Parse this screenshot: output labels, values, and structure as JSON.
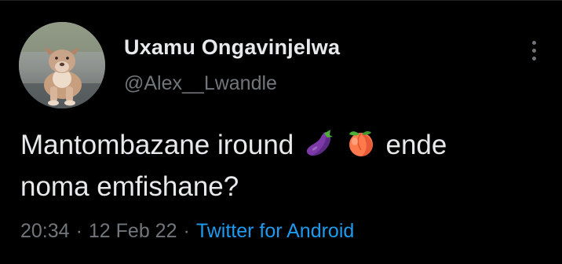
{
  "user": {
    "display_name": "Uxamu Ongavinjelwa",
    "handle": "@Alex__Lwandle",
    "avatar": "puppy-photo"
  },
  "tweet": {
    "text_part1": "Mantombazane iround",
    "emoji": [
      "eggplant-emoji",
      "peach-emoji"
    ],
    "text_part2": "ende",
    "text_line2": "noma emfishane?"
  },
  "meta": {
    "time": "20:34",
    "separator": "·",
    "date": "12 Feb 22",
    "source": "Twitter for Android"
  },
  "icons": {
    "more": "more-vertical-icon"
  },
  "colors": {
    "background": "#000000",
    "text": "#e7e9ea",
    "secondary": "#71767b",
    "link": "#1d9bf0"
  }
}
